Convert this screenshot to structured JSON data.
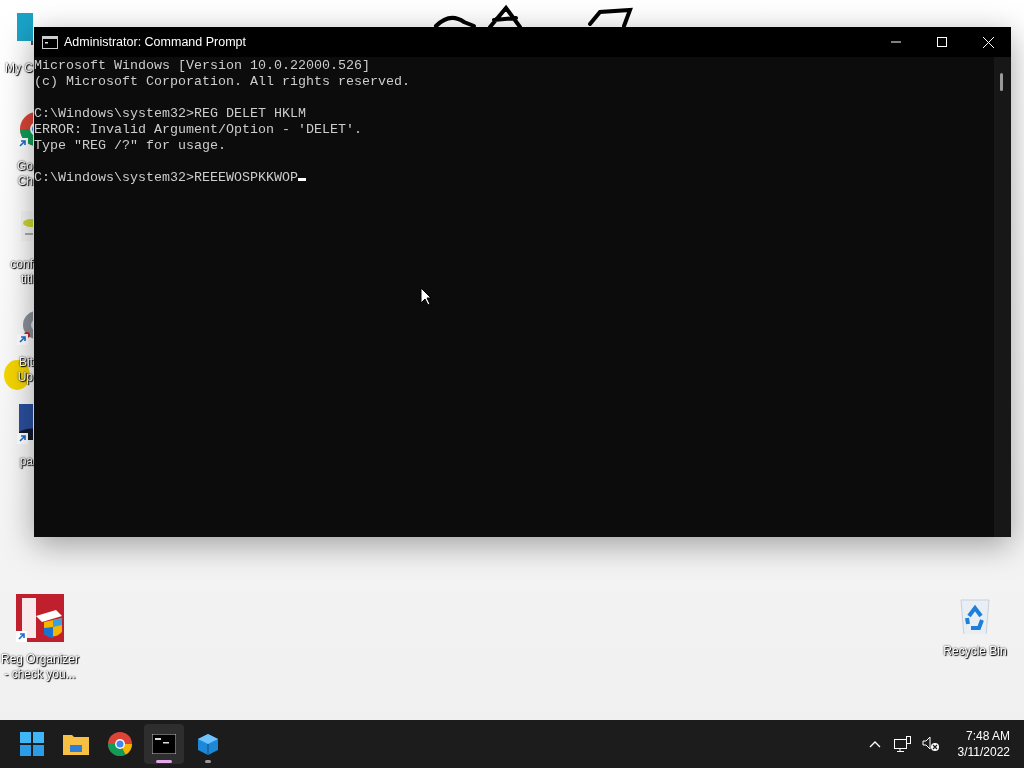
{
  "desktop": {
    "icons": [
      {
        "kind": "monitor",
        "shortcut": false,
        "lines": [
          "My C"
        ]
      },
      {
        "kind": "chrome",
        "shortcut": true,
        "lines": [
          "Go",
          "Ch"
        ]
      },
      {
        "kind": "document",
        "shortcut": false,
        "lines": [
          "conf",
          "titl"
        ]
      },
      {
        "kind": "gear",
        "shortcut": true,
        "lines": [
          "Bit",
          "Up"
        ]
      },
      {
        "kind": "image",
        "shortcut": true,
        "lines": [
          "pa"
        ]
      },
      {
        "kind": "reg",
        "shortcut": true,
        "lines": [
          "Reg Organizer",
          "- check you..."
        ]
      },
      {
        "kind": "bin",
        "shortcut": false,
        "lines": [
          "Recycle Bin"
        ]
      }
    ]
  },
  "window": {
    "title": "Administrator: Command Prompt",
    "console": {
      "blocks": [
        [
          "Microsoft Windows [Version 10.0.22000.526]",
          "(c) Microsoft Corporation. All rights reserved."
        ],
        [
          "C:\\Windows\\system32>REG DELET HKLM",
          "ERROR: Invalid Argument/Option - 'DELET'.",
          "Type \"REG /?\" for usage."
        ],
        [
          "C:\\Windows\\system32>REEEWOSPKKWOP"
        ]
      ],
      "cursor": true
    }
  },
  "taskbar": {
    "apps": [
      {
        "kind": "start",
        "active": false,
        "running": false
      },
      {
        "kind": "folder",
        "active": false,
        "running": false
      },
      {
        "kind": "chrome",
        "active": false,
        "running": false
      },
      {
        "kind": "terminal",
        "active": true,
        "running": true
      },
      {
        "kind": "cube",
        "active": false,
        "running": true
      }
    ],
    "clock": {
      "time": "7:48 AM",
      "date": "3/11/2022"
    }
  }
}
